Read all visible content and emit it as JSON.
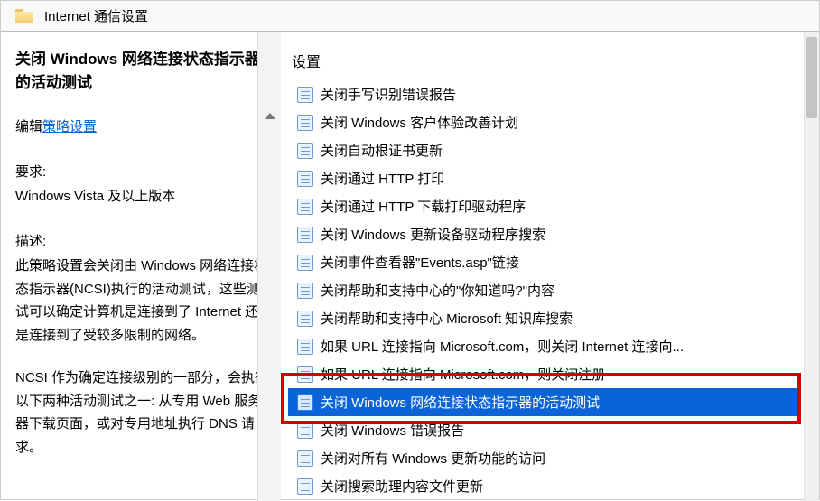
{
  "titlebar": {
    "title": "Internet 通信设置"
  },
  "left": {
    "policy_title": "关闭 Windows 网络连接状态指示器的活动测试",
    "edit_label": "编辑",
    "edit_link": "策略设置",
    "requirement_label": "要求:",
    "requirement_value": "Windows Vista 及以上版本",
    "description_label": "描述:",
    "description_text": "此策略设置会关闭由 Windows 网络连接状态指示器(NCSI)执行的活动测试，这些测试可以确定计算机是连接到了 Internet 还是连接到了受较多限制的网络。",
    "description_text2": "NCSI 作为确定连接级别的一部分，会执行以下两种活动测试之一: 从专用 Web 服务器下载页面，或对专用地址执行 DNS 请求。"
  },
  "right": {
    "heading": "设置",
    "items": [
      {
        "label": "关闭手写识别错误报告",
        "selected": false
      },
      {
        "label": "关闭 Windows 客户体验改善计划",
        "selected": false
      },
      {
        "label": "关闭自动根证书更新",
        "selected": false
      },
      {
        "label": "关闭通过 HTTP 打印",
        "selected": false
      },
      {
        "label": "关闭通过 HTTP 下载打印驱动程序",
        "selected": false
      },
      {
        "label": "关闭 Windows 更新设备驱动程序搜索",
        "selected": false
      },
      {
        "label": "关闭事件查看器\"Events.asp\"链接",
        "selected": false
      },
      {
        "label": "关闭帮助和支持中心的\"你知道吗?\"内容",
        "selected": false
      },
      {
        "label": "关闭帮助和支持中心 Microsoft 知识库搜索",
        "selected": false
      },
      {
        "label": "如果 URL 连接指向 Microsoft.com，则关闭 Internet 连接向...",
        "selected": false
      },
      {
        "label": "如果 URL 连接指向 Microsoft.com，则关闭注册",
        "selected": false
      },
      {
        "label": "关闭 Windows 网络连接状态指示器的活动测试",
        "selected": true
      },
      {
        "label": "关闭 Windows 错误报告",
        "selected": false
      },
      {
        "label": "关闭对所有 Windows 更新功能的访问",
        "selected": false
      },
      {
        "label": "关闭搜索助理内容文件更新",
        "selected": false
      }
    ]
  }
}
